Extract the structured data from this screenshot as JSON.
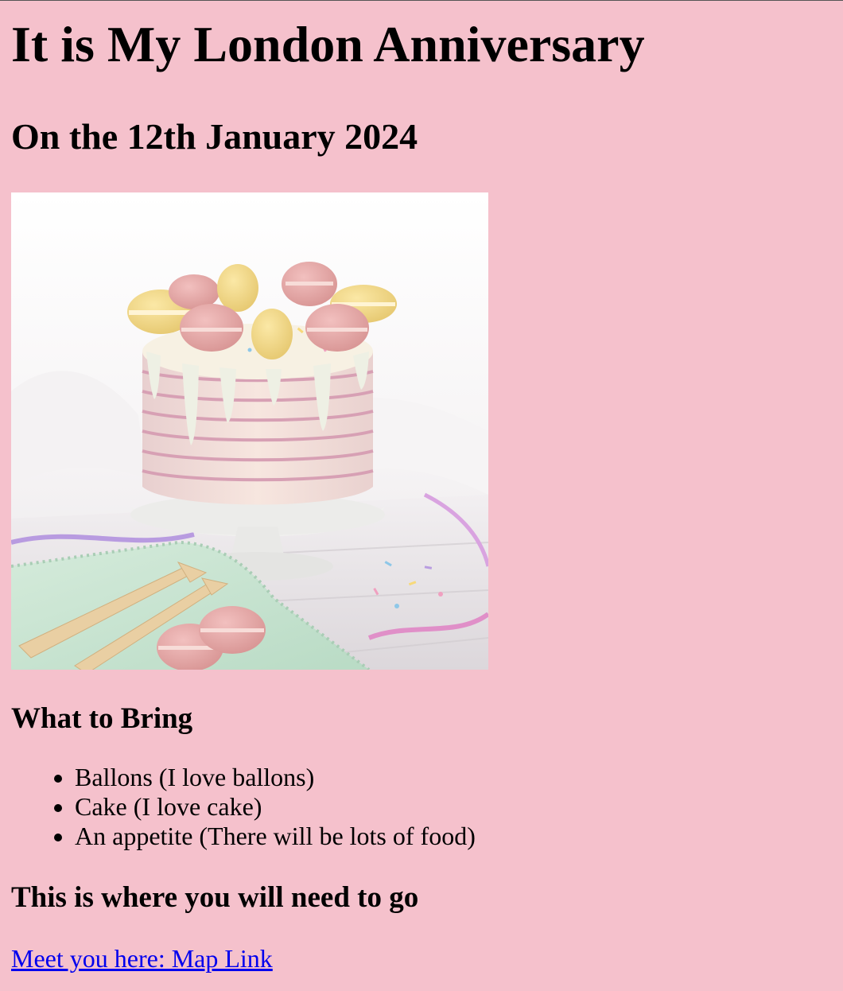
{
  "page": {
    "title": "It is My London Anniversary",
    "date_heading": "On the 12th January 2024",
    "background_color": "#f5c1cc",
    "link_color": "#0000ee"
  },
  "image": {
    "alt": "Cake with macarons"
  },
  "bring": {
    "heading": "What to Bring",
    "items": [
      "Ballons (I love ballons)",
      "Cake (I love cake)",
      "An appetite (There will be lots of food)"
    ]
  },
  "location": {
    "heading": "This is where you will need to go",
    "link_text": "Meet you here: Map Link"
  }
}
